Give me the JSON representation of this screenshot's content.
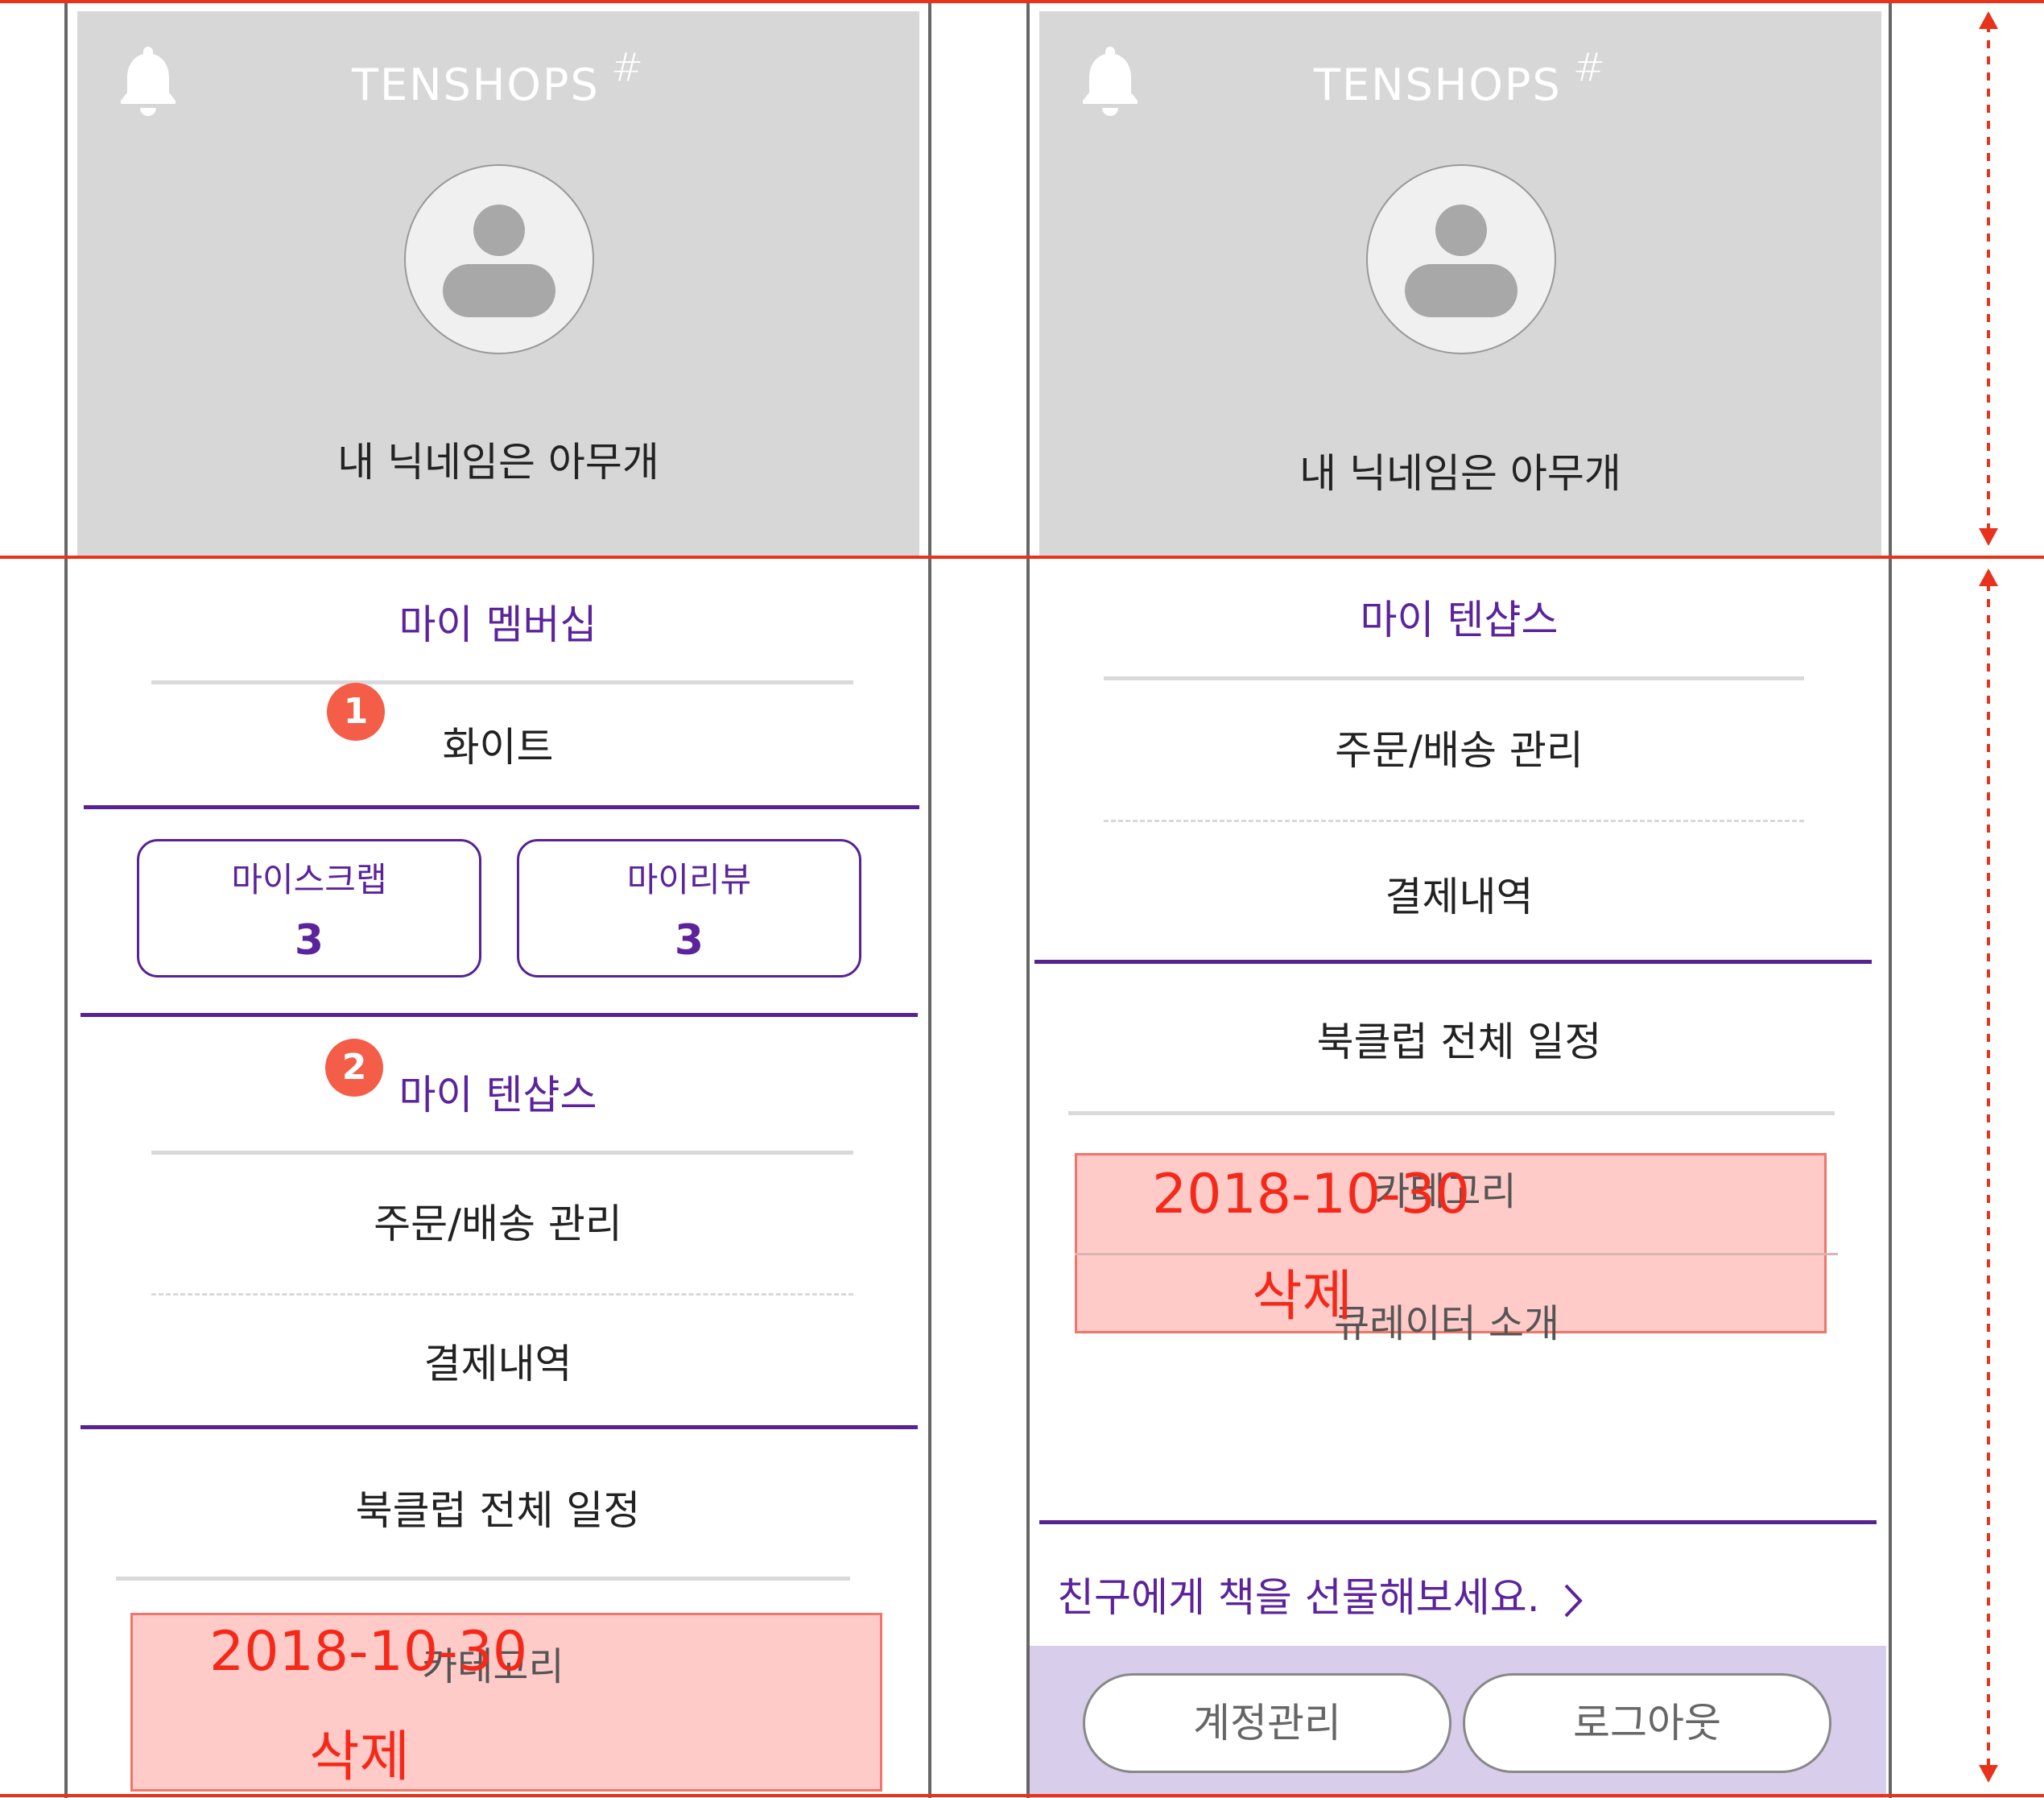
{
  "app": {
    "logo": "TENSHOPS",
    "logo_hash": "#"
  },
  "left": {
    "nickname": "내 닉네임은 아무개",
    "membership_title": "마이 멤버십",
    "membership_level": "화이트",
    "badge1": "1",
    "scrap_label": "마이스크랩",
    "scrap_count": "3",
    "review_label": "마이리뷰",
    "review_count": "3",
    "badge2": "2",
    "tenshops_title": "마이 텐샵스",
    "orders": "주문/배송 관리",
    "payments": "결제내역",
    "bookclub": "북클럽 전체 일정",
    "category": "카테고리",
    "note_date": "2018-10-30",
    "note_delete": "삭제"
  },
  "right": {
    "nickname": "내 닉네임은 아무개",
    "tenshops_title": "마이 텐샵스",
    "orders": "주문/배송 관리",
    "payments": "결제내역",
    "bookclub": "북클럽 전체 일정",
    "category": "카테고리",
    "curator": "큐레이터 소개",
    "note_date": "2018-10-30",
    "note_delete": "삭제",
    "gift_link": "친구에게 책을 선물해보세요.",
    "account_button": "계정관리",
    "logout_button": "로그아웃"
  },
  "colors": {
    "accent": "#572394",
    "annotation": "#e8331c",
    "header_bg": "#d7d7d7",
    "badge": "#f45d48"
  }
}
